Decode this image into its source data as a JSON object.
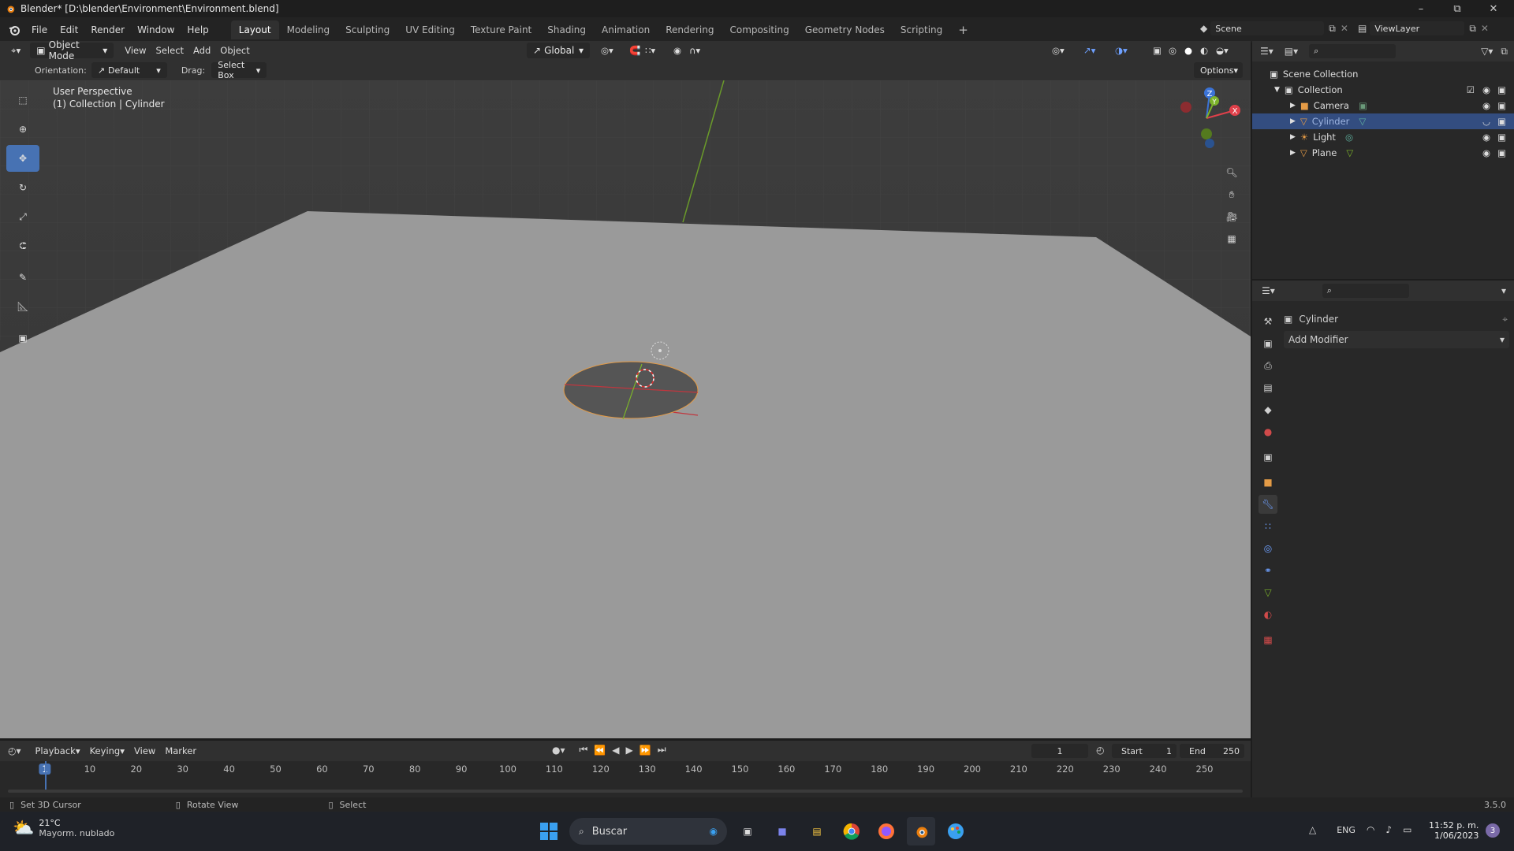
{
  "window": {
    "title": "Blender* [D:\\blender\\Environment\\Environment.blend]"
  },
  "menus": [
    "File",
    "Edit",
    "Render",
    "Window",
    "Help"
  ],
  "workspaces": [
    "Layout",
    "Modeling",
    "Sculpting",
    "UV Editing",
    "Texture Paint",
    "Shading",
    "Animation",
    "Rendering",
    "Compositing",
    "Geometry Nodes",
    "Scripting"
  ],
  "active_workspace": "Layout",
  "scene": {
    "name": "Scene",
    "view_layer": "ViewLayer"
  },
  "viewport_header": {
    "mode": "Object Mode",
    "menus": [
      "View",
      "Select",
      "Add",
      "Object"
    ],
    "transform_orientation": "Global"
  },
  "tool_settings": {
    "orientation_label": "Orientation:",
    "orientation_value": "Default",
    "drag_label": "Drag:",
    "drag_value": "Select Box",
    "options_label": "Options"
  },
  "viewport": {
    "perspective": "User Perspective",
    "context": "(1) Collection | Cylinder",
    "gizmo_axes": [
      "Z",
      "Y",
      "X"
    ]
  },
  "outliner": {
    "root": "Scene Collection",
    "collection": "Collection",
    "items": [
      {
        "label": "Camera",
        "icon": "camera-icon",
        "selected": false
      },
      {
        "label": "Cylinder",
        "icon": "mesh-icon",
        "selected": true
      },
      {
        "label": "Light",
        "icon": "light-icon",
        "selected": false
      },
      {
        "label": "Plane",
        "icon": "mesh-icon",
        "selected": false
      }
    ]
  },
  "properties": {
    "object_name": "Cylinder",
    "add_modifier": "Add Modifier"
  },
  "timeline": {
    "menus": [
      "Playback",
      "Keying",
      "View",
      "Marker"
    ],
    "current_frame": "1",
    "start_label": "Start",
    "start_value": "1",
    "end_label": "End",
    "end_value": "250",
    "ticks": [
      "1",
      "10",
      "20",
      "30",
      "40",
      "50",
      "60",
      "70",
      "80",
      "90",
      "100",
      "110",
      "120",
      "130",
      "140",
      "150",
      "160",
      "170",
      "180",
      "190",
      "200",
      "210",
      "220",
      "230",
      "240",
      "250"
    ]
  },
  "statusbar": {
    "hint1": "Set 3D Cursor",
    "hint2": "Rotate View",
    "hint3": "Select",
    "version": "3.5.0"
  },
  "taskbar": {
    "weather_temp": "21°C",
    "weather_desc": "Mayorm. nublado",
    "search_label": "Buscar",
    "lang": "ENG",
    "time": "11:52 p. m.",
    "date": "1/06/2023",
    "notif_count": "3"
  },
  "colors": {
    "accent": "#4772b3",
    "selected_row": "#334d80",
    "x_axis": "#e0404a",
    "y_axis": "#7cb32a",
    "z_axis": "#3b73d6",
    "floor": "#9a9a9a"
  }
}
